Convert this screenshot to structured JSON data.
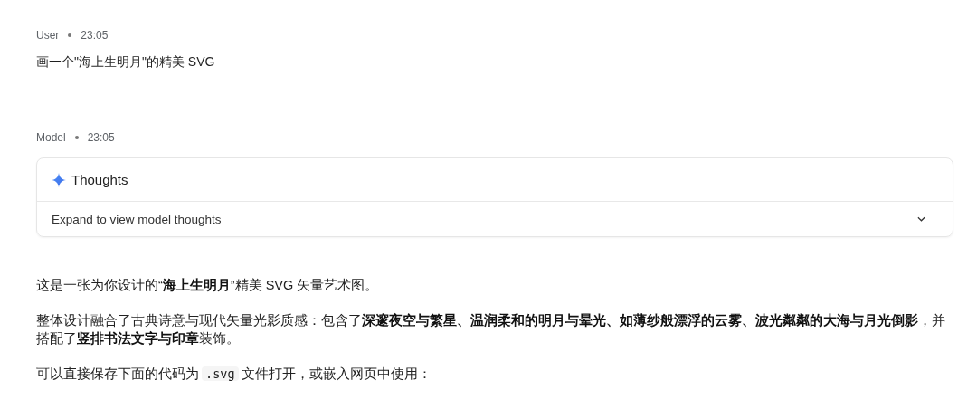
{
  "messages": [
    {
      "kind": "user",
      "author": "User",
      "time": "23:05",
      "text": "画一个\"海上生明月\"的精美 SVG"
    },
    {
      "kind": "model",
      "author": "Model",
      "time": "23:05",
      "thoughts": {
        "title": "Thoughts",
        "hint": "Expand to view model thoughts",
        "expanded": false
      },
      "paragraphs": [
        {
          "text": "这是一张为你设计的“**海上生明月**”精美 SVG 矢量艺术图。"
        },
        {
          "text": "整体设计融合了古典诗意与现代矢量光影质感：包含了**深邃夜空与繁星、温润柔和的明月与晕光、如薄纱般漂浮的云雾、波光粼粼的大海与月光倒影**，并搭配了**竖排书法文字与印章**装饰。"
        },
        {
          "parts": [
            {
              "kind": "text",
              "text": "可以直接保存下面的代码为"
            },
            {
              "kind": "code",
              "text": ".svg"
            },
            {
              "kind": "text",
              "text": "文件打开，或嵌入网页中使用："
            }
          ]
        }
      ]
    }
  ]
}
